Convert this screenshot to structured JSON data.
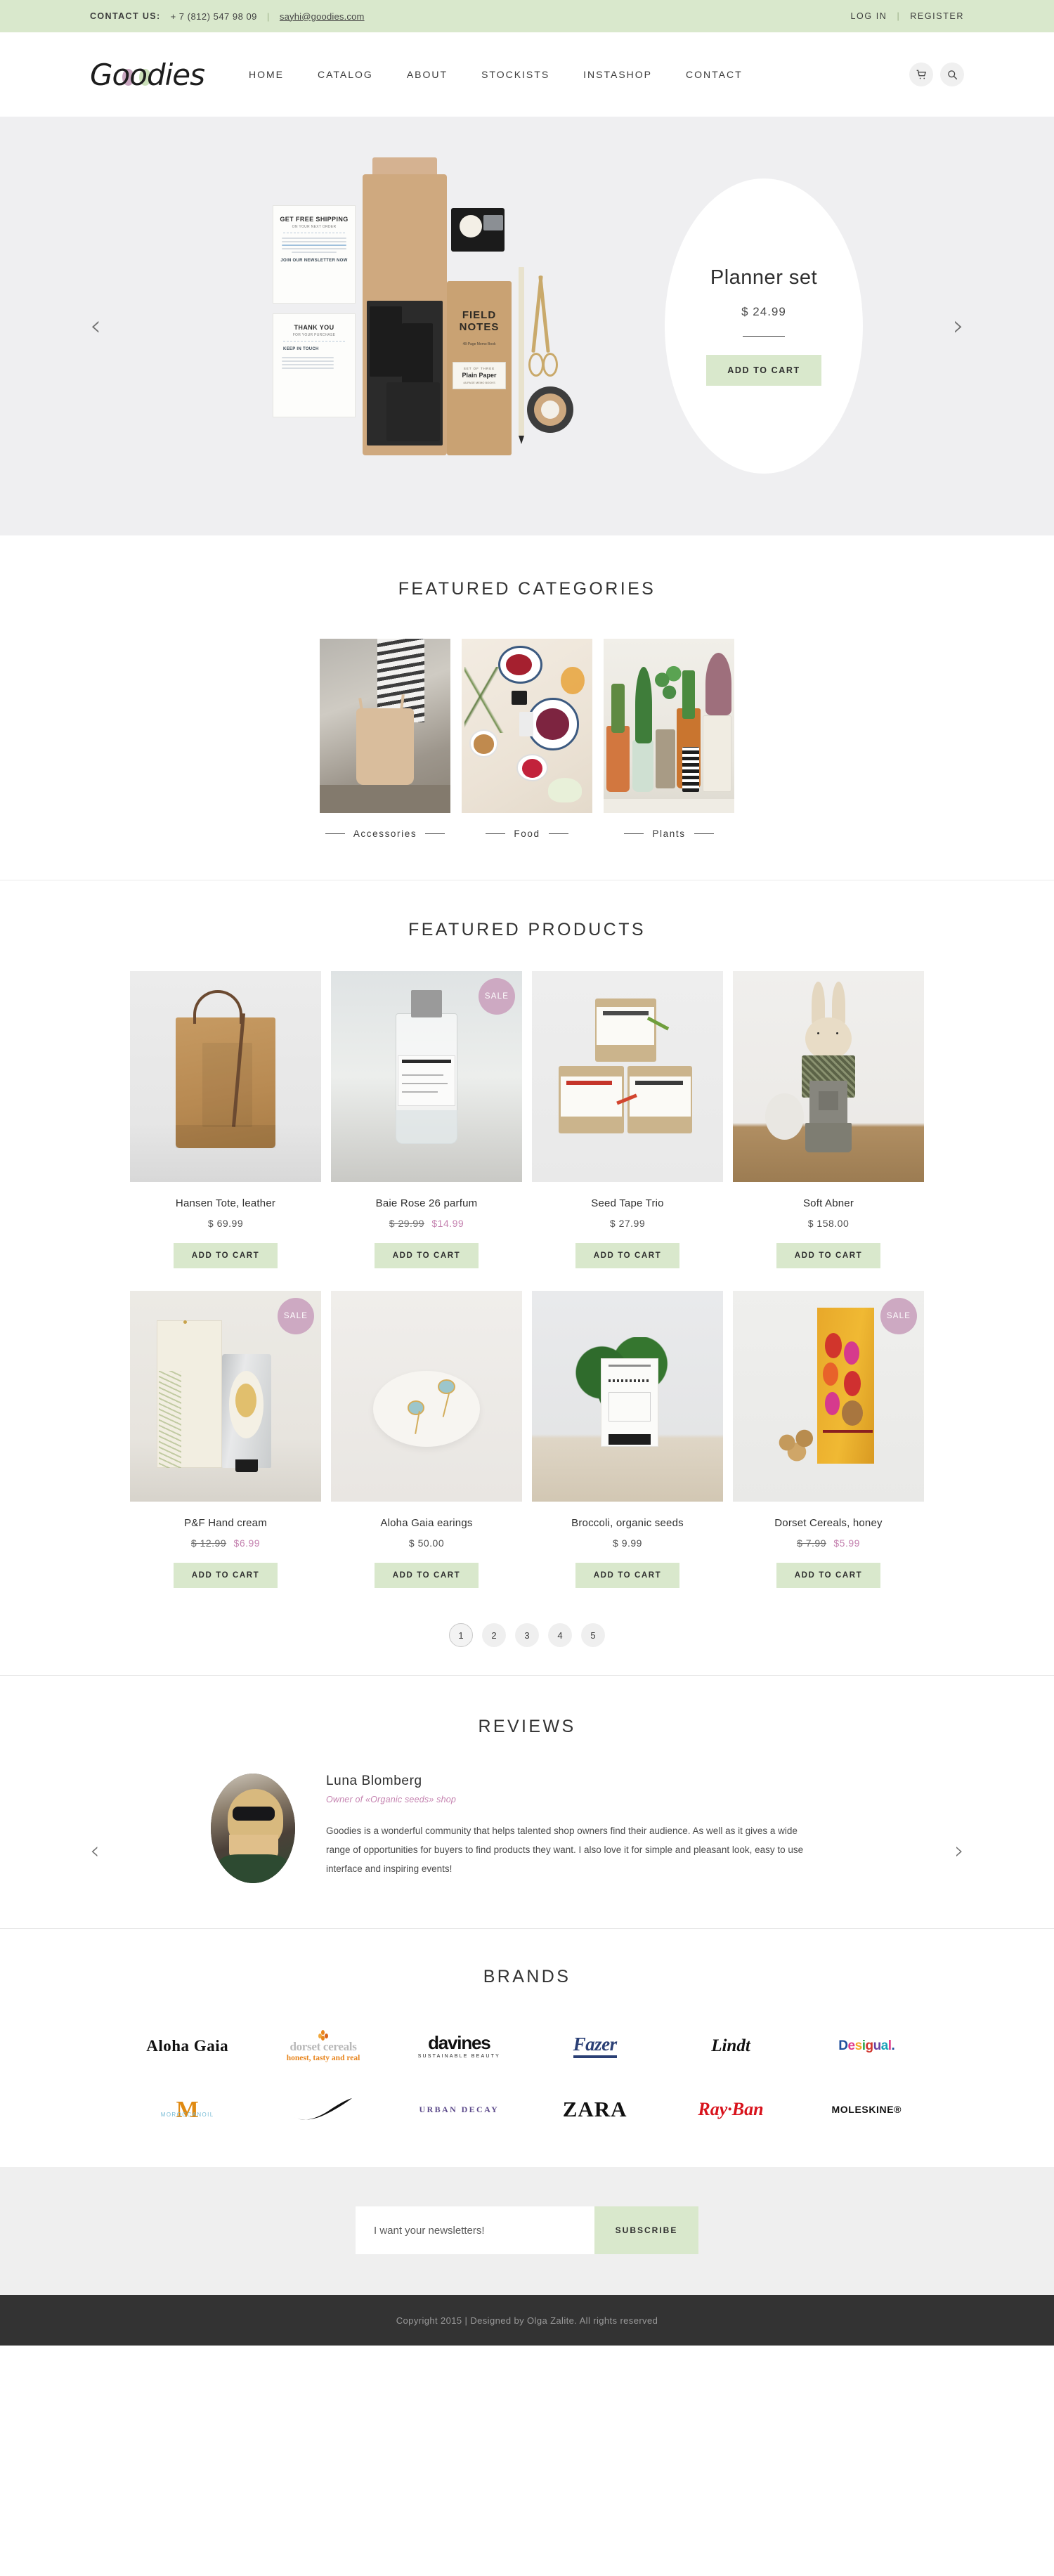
{
  "topbar": {
    "contact_label": "CONTACT US:",
    "phone": "+ 7 (812) 547 98 09",
    "separator": "|",
    "email": "sayhi@goodies.com",
    "login": "LOG IN",
    "register": "REGISTER"
  },
  "header": {
    "logo": "Goodies",
    "nav": [
      {
        "label": "HOME"
      },
      {
        "label": "CATALOG"
      },
      {
        "label": "ABOUT"
      },
      {
        "label": "STOCKISTS"
      },
      {
        "label": "INSTASHOP"
      },
      {
        "label": "CONTACT"
      }
    ],
    "cart_icon": "cart-icon",
    "search_icon": "search-icon"
  },
  "hero": {
    "prev": "‹",
    "next": "›",
    "title": "Planner set",
    "price": "$ 24.99",
    "cta": "ADD TO CART",
    "flatlay": {
      "note1_title": "GET FREE SHIPPING",
      "note1_sub": "ON YOUR NEXT ORDER",
      "note1_foot": "JOIN OUR NEWSLETTER NOW",
      "note2_title": "THANK YOU",
      "note2_sub": "FOR YOUR PURCHASE",
      "note2_foot": "KEEP IN TOUCH",
      "notebook_title": "FIELD NOTES",
      "notebook_sub": "48-Page Memo Book",
      "notebook_label_top": "SET OF THREE",
      "notebook_label_mid": "Plain Paper",
      "notebook_label_bot": "48-PAGE MEMO BOOKS"
    }
  },
  "categories": {
    "title": "FEATURED CATEGORIES",
    "items": [
      {
        "label": "Accessories"
      },
      {
        "label": "Food"
      },
      {
        "label": "Plants"
      }
    ]
  },
  "products": {
    "title": "FEATURED PRODUCTS",
    "cta": "ADD TO CART",
    "sale_badge": "SALE",
    "items": [
      {
        "name": "Hansen Tote, leather",
        "price": "$ 69.99",
        "old_price": "",
        "new_price": "",
        "on_sale": false
      },
      {
        "name": "Baie Rose 26 parfum",
        "price": "",
        "old_price": "$ 29.99",
        "new_price": "$14.99",
        "on_sale": true
      },
      {
        "name": "Seed Tape Trio",
        "price": "$ 27.99",
        "old_price": "",
        "new_price": "",
        "on_sale": false
      },
      {
        "name": "Soft Abner",
        "price": "$ 158.00",
        "old_price": "",
        "new_price": "",
        "on_sale": false
      },
      {
        "name": "P&F Hand cream",
        "price": "",
        "old_price": "$ 12.99",
        "new_price": "$6.99",
        "on_sale": true
      },
      {
        "name": "Aloha Gaia earings",
        "price": "$ 50.00",
        "old_price": "",
        "new_price": "",
        "on_sale": false
      },
      {
        "name": "Broccoli, organic seeds",
        "price": "$ 9.99",
        "old_price": "",
        "new_price": "",
        "on_sale": false
      },
      {
        "name": "Dorset Cereals, honey",
        "price": "",
        "old_price": "$ 7.99",
        "new_price": "$5.99",
        "on_sale": true
      }
    ],
    "pages": [
      "1",
      "2",
      "3",
      "4",
      "5"
    ],
    "active_page": "1"
  },
  "reviews": {
    "title": "REVIEWS",
    "prev": "‹",
    "next": "›",
    "name": "Luna Blomberg",
    "role": "Owner of «Organic seeds» shop",
    "text": "Goodies is a wonderful community that helps talented shop owners find their audience. As well as it gives a wide range of opportunities for buyers to find products they want. I also love it for simple and pleasant look, easy to use interface and inspiring events!"
  },
  "brands": {
    "title": "BRANDS",
    "row1": [
      {
        "name": "Aloha Gaia"
      },
      {
        "name": "dorset cereals",
        "tagline": "honest, tasty and real"
      },
      {
        "name": "davines",
        "tagline": "SUSTAINABLE BEAUTY"
      },
      {
        "name": "Fazer"
      },
      {
        "name": "Lindt"
      },
      {
        "name": "Desigual."
      }
    ],
    "row2": [
      {
        "name": "MOROCCANOIL"
      },
      {
        "name": "Nike"
      },
      {
        "name": "URBAN DECAY"
      },
      {
        "name": "ZARA"
      },
      {
        "name": "Ray·Ban"
      },
      {
        "name": "MOLESKINE®"
      }
    ]
  },
  "newsletter": {
    "placeholder": "I want your newsletters!",
    "value": "",
    "button": "SUBSCRIBE"
  },
  "footer": {
    "copyright": "Copyright 2015 | Designed by Olga Zalite. All rights reserved"
  },
  "colors": {
    "accent_green": "#d9e8cc",
    "sale_pink": "#cda9c2",
    "price_pink": "#c583b0",
    "hero_bg": "#efeff1",
    "footer_bg": "#333333"
  }
}
